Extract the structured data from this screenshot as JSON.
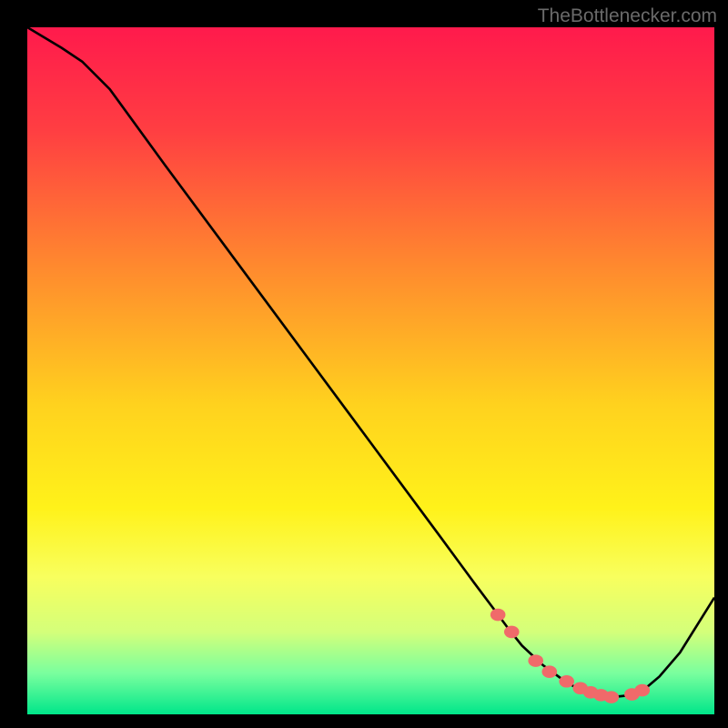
{
  "watermark": "TheBottlenecker.com",
  "chart_data": {
    "type": "line",
    "title": "",
    "xlabel": "",
    "ylabel": "",
    "x_range": [
      0,
      100
    ],
    "y_range": [
      0,
      100
    ],
    "curve": {
      "x": [
        0,
        5,
        8,
        12,
        20,
        30,
        40,
        50,
        60,
        65,
        68,
        70,
        72,
        75,
        78,
        80,
        82,
        85,
        88,
        90,
        92,
        95,
        100
      ],
      "y": [
        100,
        97,
        95,
        91,
        80,
        66.5,
        53,
        39.5,
        26,
        19.2,
        15.2,
        12.5,
        10,
        7.2,
        5,
        3.8,
        3.0,
        2.5,
        2.8,
        3.8,
        5.5,
        9,
        17
      ]
    },
    "markers": {
      "x": [
        68.5,
        70.5,
        74,
        76,
        78.5,
        80.5,
        82,
        83.5,
        85,
        88,
        89.5
      ],
      "y": [
        14.5,
        12,
        7.8,
        6.2,
        4.8,
        3.8,
        3.2,
        2.8,
        2.5,
        2.9,
        3.5
      ]
    },
    "gradient_stops": [
      {
        "pos": 0,
        "color": "#ff1a4c"
      },
      {
        "pos": 0.15,
        "color": "#ff3e42"
      },
      {
        "pos": 0.35,
        "color": "#ff8a2e"
      },
      {
        "pos": 0.55,
        "color": "#ffd21e"
      },
      {
        "pos": 0.7,
        "color": "#fff21a"
      },
      {
        "pos": 0.8,
        "color": "#f8ff5e"
      },
      {
        "pos": 0.88,
        "color": "#d4ff7a"
      },
      {
        "pos": 0.94,
        "color": "#7aff9e"
      },
      {
        "pos": 1.0,
        "color": "#00e68a"
      }
    ],
    "marker_color": "#f06a6a",
    "curve_color": "#000000"
  }
}
